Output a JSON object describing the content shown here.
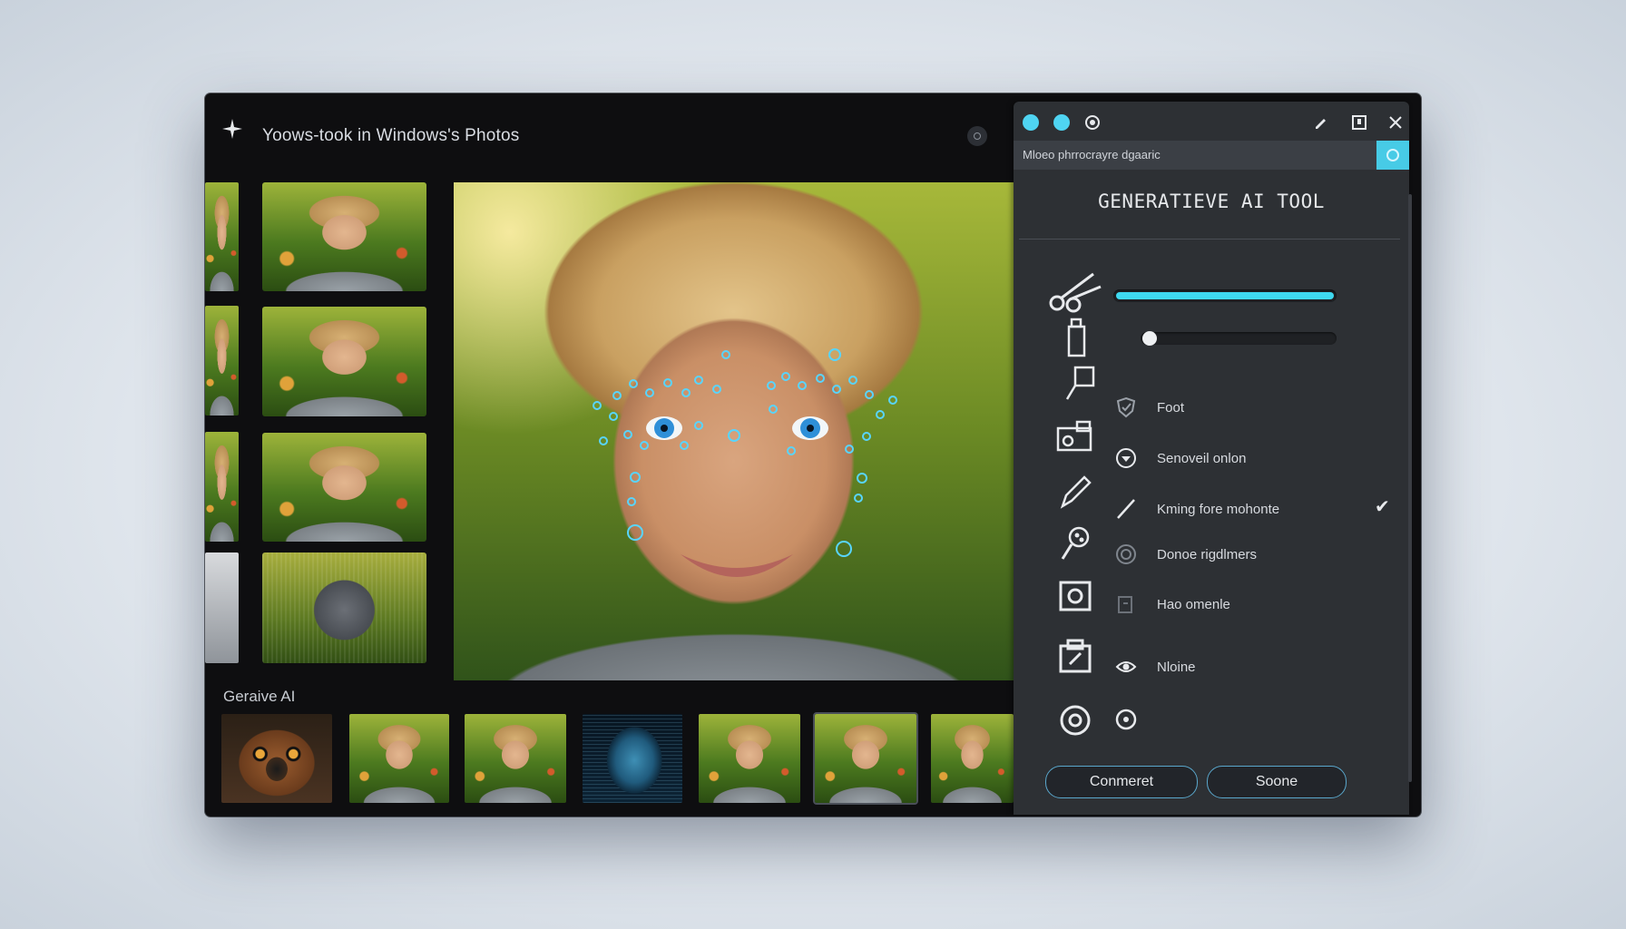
{
  "window": {
    "title": "Yoows-took in Windows's Photos"
  },
  "left_strip": {
    "thumbnails": [
      "photo-1",
      "photo-2",
      "photo-3",
      "photo-4-mesh"
    ]
  },
  "gallery": {
    "label": "Geraive AI",
    "selected_index": 5
  },
  "panel": {
    "search_text": "Mloeo phrrocrayre dgaaric",
    "title": "GENERATIEVE AI TOOL",
    "slider_1_value": 1.0,
    "slider_2_value": 0.0,
    "options": [
      {
        "label": "Foot",
        "icon": "shield-icon",
        "checked": false
      },
      {
        "label": "Senoveil onlon",
        "icon": "heart-circle-icon",
        "checked": false
      },
      {
        "label": "Kming fore mohonte",
        "icon": "slash-icon",
        "checked": true
      },
      {
        "label": "Donoe rigdlmers",
        "icon": "ring-icon",
        "checked": false
      },
      {
        "label": "Hao omenle",
        "icon": "frame-icon",
        "checked": false
      },
      {
        "label": "Nloine",
        "icon": "eye-shape-icon",
        "checked": false
      }
    ],
    "buttons": {
      "comment": "Conmeret",
      "share": "Soone"
    }
  },
  "colors": {
    "accent": "#3ed8ef",
    "panel_bg": "#2d3034",
    "window_bg": "#0e0e10"
  }
}
